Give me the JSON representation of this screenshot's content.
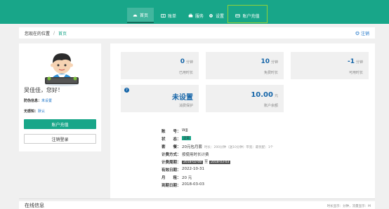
{
  "nav": {
    "items": [
      {
        "icon": "dashboard-icon",
        "label": "首页",
        "active": true
      },
      {
        "icon": "bill-icon",
        "label": "账单",
        "active": false
      },
      {
        "icon": "service-icon",
        "label": "服务",
        "active": false
      },
      {
        "icon": "gear-icon",
        "label": "设置",
        "active": false
      },
      {
        "icon": "card-icon",
        "label": "账户充值",
        "active": false
      }
    ],
    "accent": "#18a689",
    "highlight_color": "#8fd13a"
  },
  "breadcrumb": {
    "location_label": "您现在的位置",
    "home": "首页",
    "logout": "注销"
  },
  "user": {
    "greeting": "吴佳佳，您好！",
    "security_label": "防伪信息：",
    "security_value": "未设置",
    "notice_label": "无感知：",
    "notice_value": "默认",
    "recharge_button": "账户充值",
    "logout_button": "注销登录"
  },
  "stats": [
    {
      "value": "0",
      "unit": "分钟",
      "label": "已用时长"
    },
    {
      "value": "10",
      "unit": "分钟",
      "label": "免费时长"
    },
    {
      "value": "-1",
      "unit": "分钟",
      "label": "可用时长"
    },
    {
      "value": "未设置",
      "unit": "",
      "label": "消费保护",
      "help": "?"
    },
    {
      "value": "10.00",
      "unit": "元",
      "label": "账户余额"
    }
  ],
  "account": {
    "account_label": "账　　号：",
    "account_value": "WJJ",
    "status_label": "状　　态：",
    "status_value": "正常",
    "package_label": "套　　餐：",
    "package_value": "20元包月套",
    "package_note": "时长：200分钟（送10分钟）带宽：最优配：1个",
    "billing_label": "计费方式：",
    "billing_value": "按使用时长计费",
    "period_label": "计费周期：",
    "period_start": "2018-02-08",
    "period_to": "至",
    "period_end": "2018-03-03",
    "valid_label": "有效日期：",
    "valid_value": "2022-10-31",
    "monthly_label": "月　　租：",
    "monthly_value": "20 元",
    "due_label": "到期日期：",
    "due_value": "2018-03-03"
  },
  "bottom": {
    "title": "在线信息",
    "meta": "时长显示：分钟，流量显示：M"
  }
}
